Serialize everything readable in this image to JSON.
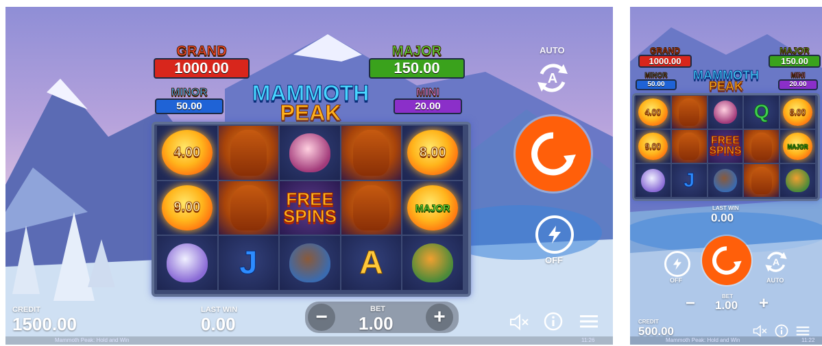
{
  "game": {
    "logo_line1": "MAMMOTH",
    "logo_line2": "PEAK"
  },
  "jackpots": {
    "grand": {
      "title": "GRAND",
      "value": "1000.00",
      "color": "#d8261c"
    },
    "major": {
      "title": "MAJOR",
      "value": "150.00",
      "color": "#3aa21c"
    },
    "minor": {
      "title": "MINOR",
      "value": "50.00",
      "color": "#1f63d6"
    },
    "mini": {
      "title": "MINI",
      "value": "20.00",
      "color": "#8b2fc9"
    }
  },
  "landscape": {
    "reels": [
      [
        "orb:4.00",
        "orb:9.00",
        "animal:dodo"
      ],
      [
        "mammoth",
        "mammoth",
        "letter:J"
      ],
      [
        "animal:rhino",
        "free_spins",
        "animal:boar"
      ],
      [
        "mammoth",
        "mammoth",
        "letter:A"
      ],
      [
        "orb:8.00",
        "orb:MAJOR",
        "animal:tiger"
      ]
    ],
    "auto_label": "AUTO",
    "turbo_label": "OFF",
    "credit_label": "CREDIT",
    "credit_value": "1500.00",
    "lastwin_label": "LAST WIN",
    "lastwin_value": "0.00",
    "bet_label": "BET",
    "bet_value": "1.00",
    "minus": "−",
    "plus": "+",
    "footer_left": "Mammoth Peak: Hold and Win",
    "footer_time": "11:26"
  },
  "portrait": {
    "reels": [
      [
        "orb:4.00",
        "orb:9.00",
        "animal:dodo"
      ],
      [
        "mammoth",
        "mammoth",
        "letter:J"
      ],
      [
        "animal:rhino",
        "free_spins",
        "animal:boar"
      ],
      [
        "letter:Q",
        "mammoth",
        "mammoth"
      ],
      [
        "orb:8.00",
        "orb:MAJOR",
        "animal:tiger"
      ]
    ],
    "lastwin_label": "LAST WIN",
    "lastwin_value": "0.00",
    "turbo_label": "OFF",
    "auto_label": "AUTO",
    "bet_label": "BET",
    "bet_value": "1.00",
    "minus": "−",
    "plus": "+",
    "credit_label": "CREDIT",
    "credit_value": "500.00",
    "footer_left": "Mammoth Peak: Hold and Win",
    "footer_time": "11:22"
  },
  "free_spins": {
    "line1": "FREE",
    "line2": "SPINS"
  },
  "icons": [
    "autoplay-icon",
    "spin-icon",
    "turbo-icon",
    "sound-muted-icon",
    "info-icon",
    "menu-icon"
  ],
  "colors": {
    "spin_button": "#ff5f0a"
  }
}
